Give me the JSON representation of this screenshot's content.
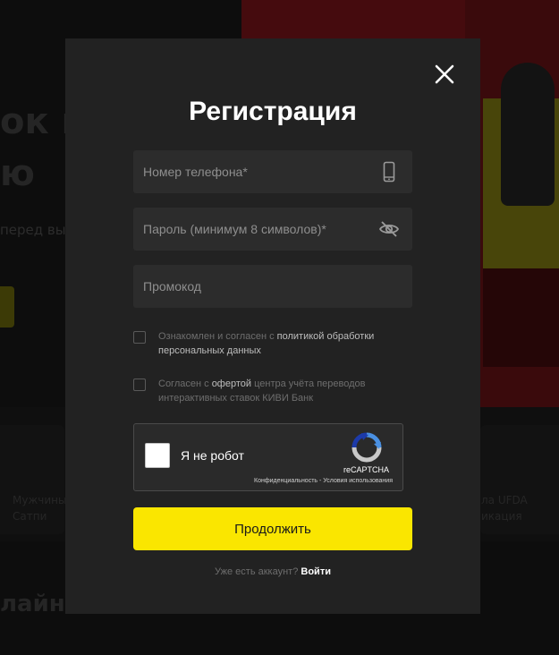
{
  "background": {
    "headline_line1": "ок ки",
    "headline_line2": "ю",
    "subtitle": "перед вы",
    "card_left_text": "Мужчины\nСатпи",
    "card_right_text": "ла UFDA\nикация",
    "bottom_heading": "лайн"
  },
  "modal": {
    "title": "Регистрация",
    "phone": {
      "placeholder": "Номер телефона*",
      "value": ""
    },
    "password": {
      "placeholder": "Пароль (минимум 8 символов)*",
      "value": ""
    },
    "promo": {
      "placeholder": "Промокод",
      "value": ""
    },
    "consent1": {
      "prefix": "Ознакомлен и согласен с ",
      "link": "политикой обработки персональных данных",
      "checked": false
    },
    "consent2": {
      "prefix": "Согласен с ",
      "link": "офертой",
      "suffix": " центра учёта переводов интерактивных ставок КИВИ Банк",
      "checked": false
    },
    "captcha": {
      "label": "Я не робот",
      "brand": "reCAPTCHA",
      "privacy": "Конфиденциальность",
      "separator": " - ",
      "terms": "Условия использования"
    },
    "continue_label": "Продолжить",
    "login_question": "Уже есть аккаунт? ",
    "login_link": "Войти"
  },
  "colors": {
    "accent": "#fae600",
    "modal_bg": "#222222",
    "field_bg": "#2c2c2c"
  },
  "icons": [
    "close-icon",
    "phone-icon",
    "eye-off-icon",
    "recaptcha-icon"
  ]
}
